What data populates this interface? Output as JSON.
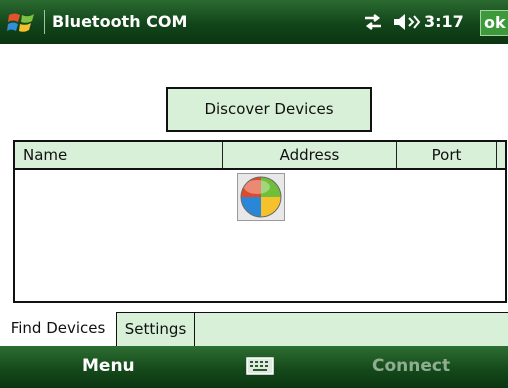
{
  "title_bar": {
    "app_title": "Bluetooth COM",
    "time": "3:17",
    "ok_label": "ok",
    "icons": [
      "windows-start-icon",
      "connectivity-icon",
      "volume-icon"
    ]
  },
  "main": {
    "discover_button_label": "Discover Devices",
    "device_list": {
      "columns": [
        "Name",
        "Address",
        "Port"
      ],
      "rows": [],
      "busy_indicator": "windows-busy-icon"
    }
  },
  "tabs": [
    {
      "label": "Find Devices",
      "selected": true
    },
    {
      "label": "Settings",
      "selected": false
    }
  ],
  "menu_bar": {
    "left_softkey": "Menu",
    "center_icon": "keyboard-icon",
    "right_softkey": "Connect",
    "right_softkey_enabled": false
  },
  "colors": {
    "bar_green": "#1b5520",
    "panel_green": "#d8f0d8",
    "ok_green": "#3c9a3a",
    "disabled_text": "#8fae8f"
  }
}
